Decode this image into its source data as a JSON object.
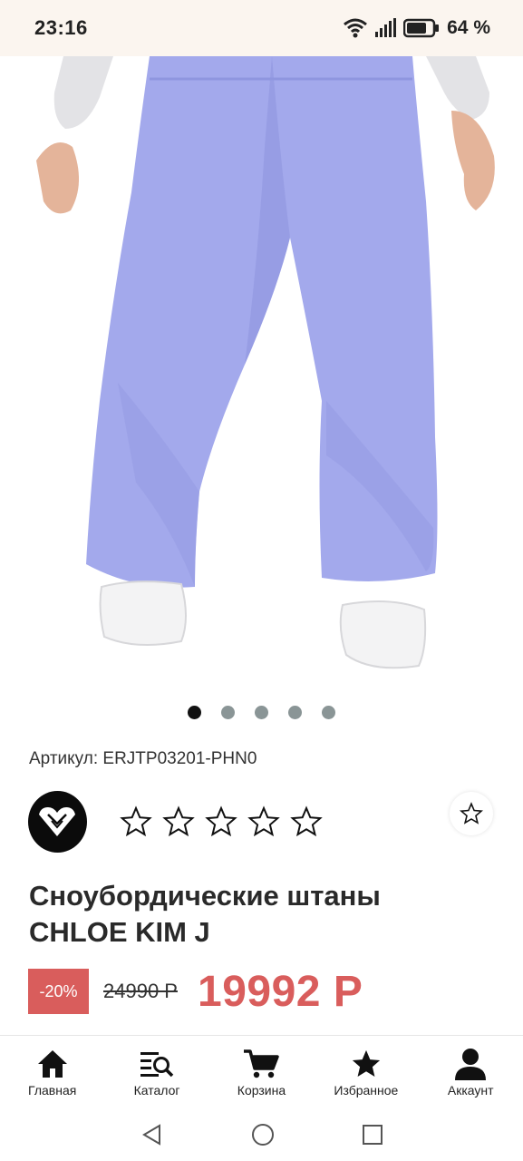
{
  "status_bar": {
    "time": "23:16",
    "battery_percent": "64 %",
    "icons": [
      "wifi-icon",
      "signal-icon",
      "battery-icon"
    ]
  },
  "gallery": {
    "image_description_icon": "product-photo",
    "dot_count": 5,
    "active_index": 0
  },
  "product": {
    "sku": "Артикул: ERJTP03201-PHN0",
    "title_line1": "Сноубордические штаны",
    "title_line2": "CHLOE KIM J",
    "rating_stars": 0,
    "discount": "-20%",
    "old_price": "24990 Р",
    "new_price": "19992 Р"
  },
  "bottom_nav": {
    "items": [
      {
        "label": "Главная",
        "icon": "home-icon"
      },
      {
        "label": "Каталог",
        "icon": "catalog-search-icon"
      },
      {
        "label": "Корзина",
        "icon": "cart-icon"
      },
      {
        "label": "Избранное",
        "icon": "star-icon"
      },
      {
        "label": "Аккаунт",
        "icon": "user-icon"
      }
    ]
  },
  "colors": {
    "accent": "#d95d5c",
    "status_bar_bg": "#fbf5ef",
    "pants": "#a3a9ec"
  }
}
